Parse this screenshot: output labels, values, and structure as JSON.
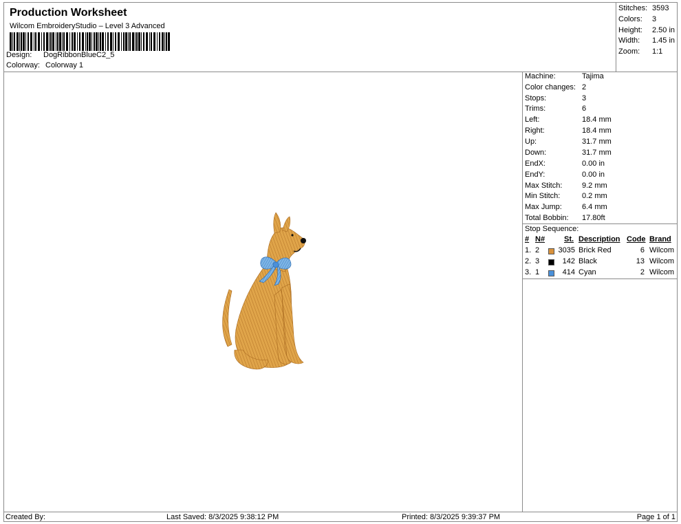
{
  "header": {
    "title": "Production Worksheet",
    "subtitle": "Wilcom EmbroideryStudio – Level 3 Advanced",
    "design_label": "Design:",
    "design_value": "DogRibbonBlueC2_5",
    "colorway_label": "Colorway:",
    "colorway_value": "Colorway 1"
  },
  "stats": [
    {
      "k": "Stitches:",
      "v": "3593"
    },
    {
      "k": "Colors:",
      "v": "3"
    },
    {
      "k": "Height:",
      "v": "2.50 in"
    },
    {
      "k": "Width:",
      "v": "1.45 in"
    },
    {
      "k": "Zoom:",
      "v": "1:1"
    }
  ],
  "machine_info": [
    {
      "k": "Machine:",
      "v": "Tajima"
    },
    {
      "k": "Color changes:",
      "v": "2"
    },
    {
      "k": "Stops:",
      "v": "3"
    },
    {
      "k": "Trims:",
      "v": "6"
    },
    {
      "k": "Left:",
      "v": "18.4 mm"
    },
    {
      "k": "Right:",
      "v": "18.4 mm"
    },
    {
      "k": "Up:",
      "v": "31.7 mm"
    },
    {
      "k": "Down:",
      "v": "31.7 mm"
    },
    {
      "k": "EndX:",
      "v": "0.00 in"
    },
    {
      "k": "EndY:",
      "v": "0.00 in"
    },
    {
      "k": "Max Stitch:",
      "v": "9.2 mm"
    },
    {
      "k": "Min Stitch:",
      "v": "0.2 mm"
    },
    {
      "k": "Max Jump:",
      "v": "6.4 mm"
    },
    {
      "k": "Total Bobbin:",
      "v": "17.80ft"
    }
  ],
  "stop_sequence": {
    "label": "Stop Sequence:",
    "headers": {
      "num": "#",
      "n": "N#",
      "st": "St.",
      "desc": "Description",
      "code": "Code",
      "brand": "Brand"
    },
    "rows": [
      {
        "num": "1.",
        "n": "2",
        "color": "#d9923c",
        "st": "3035",
        "desc": "Brick Red",
        "code": "6",
        "brand": "Wilcom"
      },
      {
        "num": "2.",
        "n": "3",
        "color": "#000000",
        "st": "142",
        "desc": "Black",
        "code": "13",
        "brand": "Wilcom"
      },
      {
        "num": "3.",
        "n": "1",
        "color": "#4a90d9",
        "st": "414",
        "desc": "Cyan",
        "code": "2",
        "brand": "Wilcom"
      }
    ]
  },
  "footer": {
    "created_by": "Created By:",
    "last_saved": "Last Saved: 8/3/2025 9:38:12 PM",
    "printed": "Printed: 8/3/2025 9:39:37 PM",
    "page": "Page 1 of 1"
  }
}
